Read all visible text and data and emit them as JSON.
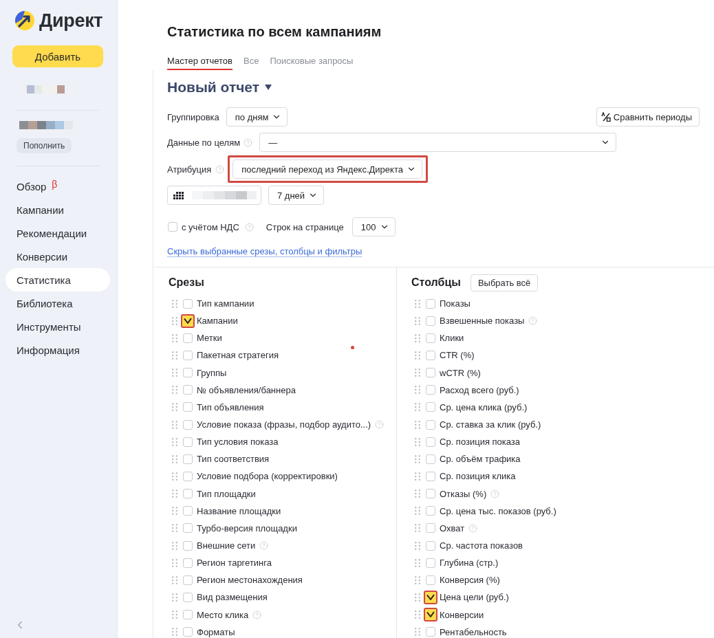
{
  "sidebar": {
    "logo_text": "Директ",
    "add_button": "Добавить",
    "top_up_button": "Пополнить",
    "nav": [
      {
        "label": "Обзор",
        "badge": "β",
        "selected": false
      },
      {
        "label": "Кампании",
        "selected": false
      },
      {
        "label": "Рекомендации",
        "selected": false
      },
      {
        "label": "Конверсии",
        "selected": false
      },
      {
        "label": "Статистика",
        "selected": true
      },
      {
        "label": "Библиотека",
        "selected": false
      },
      {
        "label": "Инструменты",
        "selected": false
      },
      {
        "label": "Информация",
        "selected": false
      }
    ]
  },
  "header": {
    "title": "Статистика по всем кампаниям",
    "tabs": [
      {
        "label": "Мастер отчетов",
        "selected": true
      },
      {
        "label": "Все",
        "selected": false
      },
      {
        "label": "Поисковые запросы",
        "selected": false
      }
    ]
  },
  "report": {
    "title": "Новый отчет",
    "grouping": {
      "label": "Группировка",
      "value": "по дням"
    },
    "compare_button": "Сравнить периоды",
    "goals": {
      "label": "Данные по целям",
      "help": true,
      "value": "—"
    },
    "attribution": {
      "label": "Атрибуция",
      "help": true,
      "value": "последний переход из Яндекс.Директа",
      "highlighted": true
    },
    "period": {
      "value": "7 дней"
    },
    "vat": {
      "label": "с учётом НДС",
      "checked": false,
      "help": true
    },
    "rows_per_page": {
      "label": "Строк на странице",
      "value": "100"
    },
    "toggle_link": "Скрыть выбранные срезы, столбцы и фильтры"
  },
  "slices": {
    "title": "Срезы",
    "annotation_dot": true,
    "items": [
      {
        "label": "Тип кампании",
        "checked": false,
        "help": false
      },
      {
        "label": "Кампании",
        "checked": true,
        "help": false
      },
      {
        "label": "Метки",
        "checked": false,
        "help": false
      },
      {
        "label": "Пакетная стратегия",
        "checked": false,
        "help": false
      },
      {
        "label": "Группы",
        "checked": false,
        "help": false
      },
      {
        "label": "№ объявления/баннера",
        "checked": false,
        "help": false
      },
      {
        "label": "Тип объявления",
        "checked": false,
        "help": false
      },
      {
        "label": "Условие показа (фразы, подбор аудито...)",
        "checked": false,
        "help": true
      },
      {
        "label": "Тип условия показа",
        "checked": false,
        "help": false
      },
      {
        "label": "Тип соответствия",
        "checked": false,
        "help": false
      },
      {
        "label": "Условие подбора (корректировки)",
        "checked": false,
        "help": false
      },
      {
        "label": "Тип площадки",
        "checked": false,
        "help": false
      },
      {
        "label": "Название площадки",
        "checked": false,
        "help": false
      },
      {
        "label": "Турбо-версия площадки",
        "checked": false,
        "help": false
      },
      {
        "label": "Внешние сети",
        "checked": false,
        "help": true
      },
      {
        "label": "Регион таргетинга",
        "checked": false,
        "help": false
      },
      {
        "label": "Регион местонахождения",
        "checked": false,
        "help": false
      },
      {
        "label": "Вид размещения",
        "checked": false,
        "help": false
      },
      {
        "label": "Место клика",
        "checked": false,
        "help": true
      },
      {
        "label": "Форматы",
        "checked": false,
        "help": false
      }
    ]
  },
  "columns": {
    "title": "Столбцы",
    "select_all_button": "Выбрать всё",
    "items": [
      {
        "label": "Показы",
        "checked": false,
        "help": false
      },
      {
        "label": "Взвешенные показы",
        "checked": false,
        "help": true
      },
      {
        "label": "Клики",
        "checked": false,
        "help": false
      },
      {
        "label": "CTR (%)",
        "checked": false,
        "help": false
      },
      {
        "label": "wCTR (%)",
        "checked": false,
        "help": false
      },
      {
        "label": "Расход всего (руб.)",
        "checked": false,
        "help": false
      },
      {
        "label": "Ср. цена клика (руб.)",
        "checked": false,
        "help": false
      },
      {
        "label": "Ср. ставка за клик (руб.)",
        "checked": false,
        "help": false
      },
      {
        "label": "Ср. позиция показа",
        "checked": false,
        "help": false
      },
      {
        "label": "Ср. объём трафика",
        "checked": false,
        "help": false
      },
      {
        "label": "Ср. позиция клика",
        "checked": false,
        "help": false
      },
      {
        "label": "Отказы (%)",
        "checked": false,
        "help": true
      },
      {
        "label": "Ср. цена тыс. показов (руб.)",
        "checked": false,
        "help": false
      },
      {
        "label": "Охват",
        "checked": false,
        "help": true
      },
      {
        "label": "Ср. частота показов",
        "checked": false,
        "help": false
      },
      {
        "label": "Глубина (стр.)",
        "checked": false,
        "help": false
      },
      {
        "label": "Конверсия (%)",
        "checked": false,
        "help": false
      },
      {
        "label": "Цена цели (руб.)",
        "checked": true,
        "help": false
      },
      {
        "label": "Конверсии",
        "checked": true,
        "help": false
      },
      {
        "label": "Рентабельность",
        "checked": false,
        "help": false
      }
    ]
  }
}
